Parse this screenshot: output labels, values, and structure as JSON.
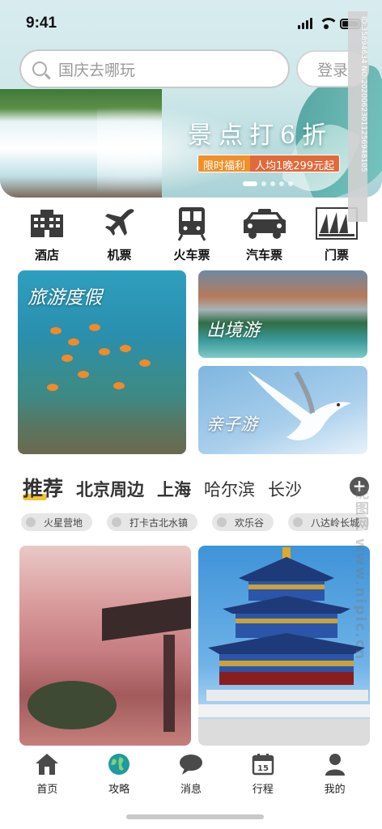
{
  "status_bar": {
    "time": "9:41"
  },
  "header": {
    "search_placeholder": "国庆去哪玩",
    "login_label": "登录"
  },
  "banner": {
    "slogan": "景点打6折",
    "promo_tag": "限时福利",
    "promo_text": "人均1晚299元起",
    "active_dot": 0,
    "dot_count": 5
  },
  "categories": [
    {
      "label": "酒店",
      "icon": "hotel-icon"
    },
    {
      "label": "机票",
      "icon": "airplane-icon"
    },
    {
      "label": "火车票",
      "icon": "train-icon"
    },
    {
      "label": "汽车票",
      "icon": "car-icon"
    },
    {
      "label": "门票",
      "icon": "ticket-icon"
    }
  ],
  "tiles": {
    "vacation": "旅游度假",
    "outbound": "出境游",
    "family": "亲子游"
  },
  "recommend": {
    "tabs": [
      "推荐",
      "北京周边",
      "上海",
      "哈尔滨",
      "长沙"
    ],
    "active_tab": 0,
    "add_label": "+",
    "chips": [
      "火星营地",
      "打卡古北水镇",
      "欢乐谷",
      "八达岭长城"
    ]
  },
  "bottom_nav": [
    {
      "label": "首页",
      "icon": "home-icon"
    },
    {
      "label": "攻略",
      "icon": "globe-icon"
    },
    {
      "label": "消息",
      "icon": "message-icon"
    },
    {
      "label": "行程",
      "icon": "calendar-icon",
      "calendar_day": "15"
    },
    {
      "label": "我的",
      "icon": "user-icon"
    }
  ],
  "watermark": {
    "id_text": "ID:35894634 NO:20200623011256948105",
    "site_text": "昵图网 www.nipic.cn"
  },
  "colors": {
    "accent_yellow": "#f2c330",
    "promo_orange": "#f0902a",
    "text_dark": "#222222"
  }
}
